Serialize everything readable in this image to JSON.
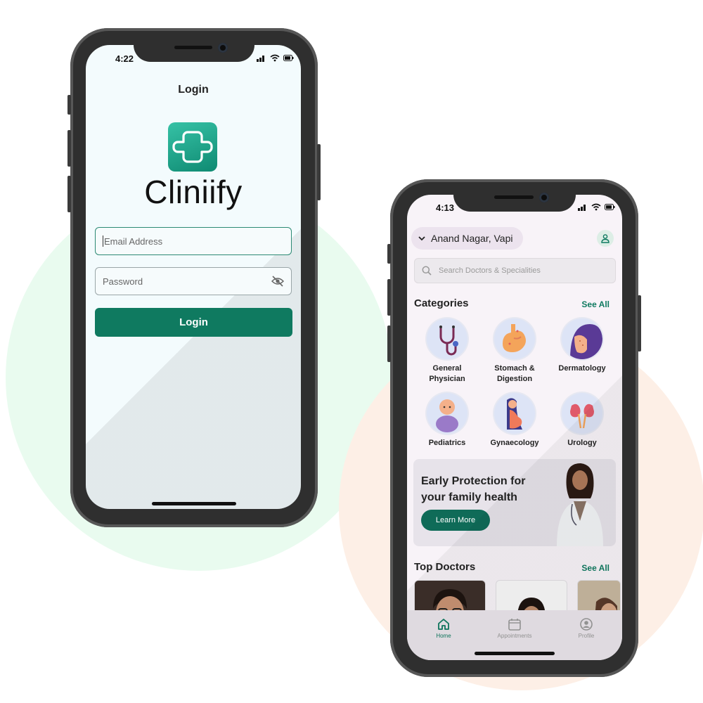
{
  "login_screen": {
    "status_time": "4:22",
    "title": "Login",
    "brand_name": "Cliniify",
    "email_placeholder": "Email Address",
    "password_placeholder": "Password",
    "login_button": "Login"
  },
  "home_screen": {
    "status_time": "4:13",
    "location": "Anand Nagar, Vapi",
    "search_placeholder": "Search Doctors & Specialities",
    "categories_title": "Categories",
    "categories_see_all": "See All",
    "categories": [
      {
        "line1": "General",
        "line2": "Physician",
        "icon": "stethoscope-icon"
      },
      {
        "line1": "Stomach &",
        "line2": "Digestion",
        "icon": "stomach-icon"
      },
      {
        "line1": "Dermatology",
        "line2": "",
        "icon": "dermatology-icon"
      },
      {
        "line1": "Pediatrics",
        "line2": "",
        "icon": "baby-icon"
      },
      {
        "line1": "Gynaecology",
        "line2": "",
        "icon": "pregnant-woman-icon"
      },
      {
        "line1": "Urology",
        "line2": "",
        "icon": "kidney-icon"
      }
    ],
    "banner": {
      "line1": "Early Protection for",
      "line2": "your family health",
      "button": "Learn More"
    },
    "top_doctors_title": "Top Doctors",
    "top_doctors_see_all": "See All",
    "tabs": [
      {
        "label": "Home",
        "icon": "home-icon",
        "active": true
      },
      {
        "label": "Appointments",
        "icon": "calendar-icon",
        "active": false
      },
      {
        "label": "Profile",
        "icon": "profile-icon",
        "active": false
      }
    ]
  },
  "colors": {
    "brand_green": "#0f7a60",
    "logo_teal": "#1fa98d",
    "bg_green_blob": "#e9fbef",
    "bg_peach_blob": "#fdefe6"
  }
}
